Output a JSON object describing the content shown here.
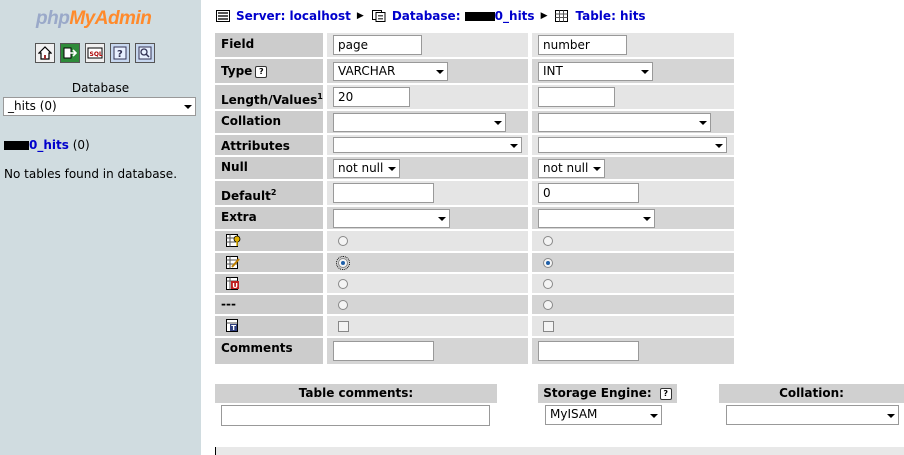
{
  "sidebar": {
    "logo_php": "php",
    "logo_myadmin": "MyAdmin",
    "icons": [
      "home-icon",
      "exit-icon",
      "sql-icon",
      "help-icon",
      "docs-icon"
    ],
    "database_label": "Database",
    "database_select": "_hits (0)",
    "db_link_text": "0_hits",
    "db_link_count": "(0)",
    "no_tables": "No tables found in database."
  },
  "breadcrumb": {
    "server": "Server: localhost",
    "database_prefix": "Database: ",
    "database_suffix": "0_hits",
    "table": "Table: hits"
  },
  "form": {
    "labels": {
      "field": "Field",
      "type": "Type",
      "length": "Length/Values",
      "length_sup": "1",
      "collation": "Collation",
      "attributes": "Attributes",
      "null": "Null",
      "default": "Default",
      "default_sup": "2",
      "extra": "Extra",
      "none_index": "---",
      "comments": "Comments"
    },
    "columns": [
      {
        "field": "page",
        "type": "VARCHAR",
        "length": "20",
        "collation": "",
        "attributes": "",
        "null": "not null",
        "default": "",
        "extra": "",
        "index_selected": "index",
        "fulltext": false,
        "comments": ""
      },
      {
        "field": "number",
        "type": "INT",
        "length": "",
        "collation": "",
        "attributes": "",
        "null": "not null",
        "default": "0",
        "extra": "",
        "index_selected": "index",
        "fulltext": false,
        "comments": ""
      }
    ]
  },
  "options": {
    "table_comments_label": "Table comments:",
    "table_comments_value": "",
    "storage_engine_label": "Storage Engine:",
    "storage_engine_value": "MyISAM",
    "collation_label": "Collation:",
    "collation_value": ""
  },
  "colors": {
    "sidebar_bg": "#d0dce0",
    "header_cell": "#cccccc",
    "link": "#0000cc"
  }
}
